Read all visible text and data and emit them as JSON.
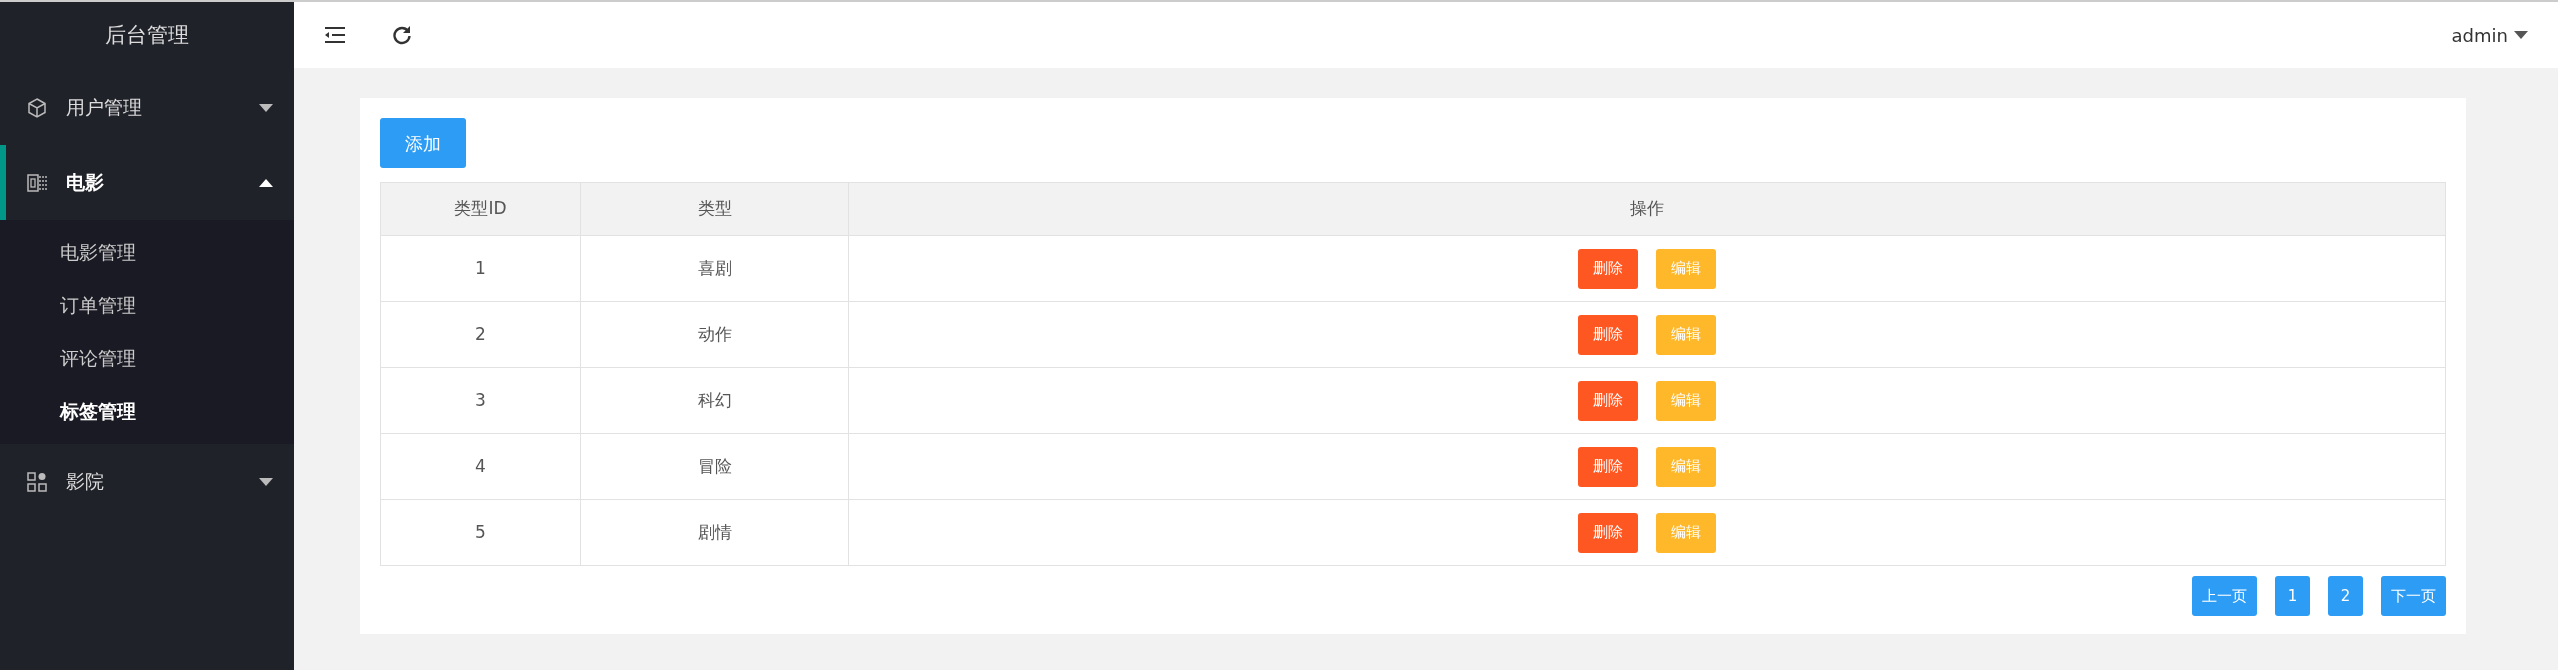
{
  "sidebar": {
    "title": "后台管理",
    "menu": [
      {
        "label": "用户管理",
        "selected": false,
        "expanded": false
      },
      {
        "label": "电影",
        "selected": true,
        "expanded": true,
        "children": [
          {
            "label": "电影管理",
            "selected": false
          },
          {
            "label": "订单管理",
            "selected": false
          },
          {
            "label": "评论管理",
            "selected": false
          },
          {
            "label": "标签管理",
            "selected": true
          }
        ]
      },
      {
        "label": "影院",
        "selected": false,
        "expanded": false
      }
    ]
  },
  "topbar": {
    "user": "admin"
  },
  "add_button": "添加",
  "table": {
    "columns": [
      "类型ID",
      "类型",
      "操作"
    ],
    "rows": [
      {
        "id": "1",
        "type": "喜剧",
        "actions": [
          "删除",
          "编辑"
        ]
      },
      {
        "id": "2",
        "type": "动作",
        "actions": [
          "删除",
          "编辑"
        ]
      },
      {
        "id": "3",
        "type": "科幻",
        "actions": [
          "删除",
          "编辑"
        ]
      },
      {
        "id": "4",
        "type": "冒险",
        "actions": [
          "删除",
          "编辑"
        ]
      },
      {
        "id": "5",
        "type": "剧情",
        "actions": [
          "删除",
          "编辑"
        ]
      }
    ]
  },
  "pagination": {
    "previous": "上一页",
    "pages": [
      "1",
      "2"
    ],
    "next": "下一页"
  }
}
